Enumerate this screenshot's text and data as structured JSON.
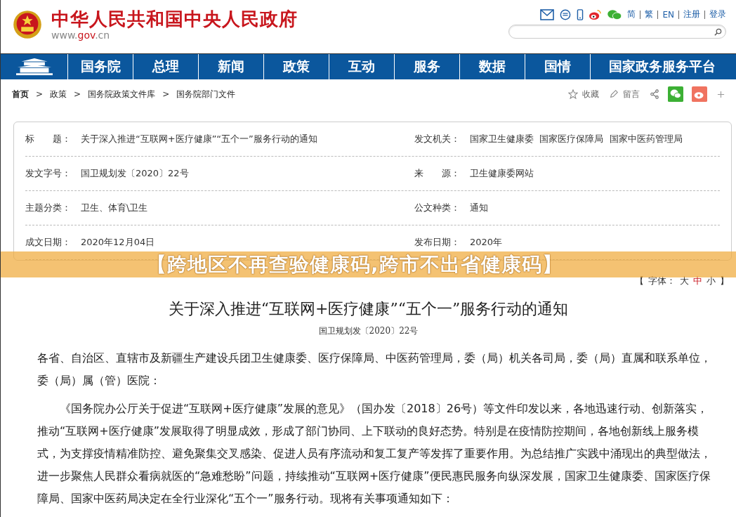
{
  "site": {
    "title": "中华人民共和国中央人民政府",
    "domain_prefix": "www.",
    "domain_main": "gov",
    "domain_suffix": ".cn"
  },
  "top_links": [
    "简",
    "繁",
    "EN",
    "注册",
    "登录"
  ],
  "nav": [
    "国务院",
    "总理",
    "新闻",
    "政策",
    "互动",
    "服务",
    "数据",
    "国情",
    "国家政务服务平台"
  ],
  "breadcrumb": [
    "首页",
    "政策",
    "国务院政策文件库",
    "国务院部门文件"
  ],
  "breadcrumb_sep": ">",
  "actions": {
    "favorite": "收藏",
    "comment": "留言"
  },
  "info": [
    {
      "label": "标　　题：",
      "value": "关于深入推进“互联网+医疗健康”“五个一”服务行动的通知",
      "label2": "发文机关：",
      "value2": "国家卫生健康委  国家医疗保障局  国家中医药管理局"
    },
    {
      "label": "发文字号：",
      "value": "国卫规划发〔2020〕22号",
      "label2": "来　　源：",
      "value2": "卫生健康委网站"
    },
    {
      "label": "主题分类：",
      "value": "卫生、体育\\卫生",
      "label2": "公文种类：",
      "value2": "通知"
    },
    {
      "label": "成文日期：",
      "value": "2020年12月04日",
      "label2": "发布日期：",
      "value2": "2020年"
    }
  ],
  "banner": "【跨地区不再查验健康码,跨市不出省健康码】",
  "font_size": {
    "open": "【",
    "label": "字体：",
    "close": "】",
    "sizes": [
      {
        "label": "大",
        "selected": false
      },
      {
        "label": "中",
        "selected": true
      },
      {
        "label": "小",
        "selected": false
      }
    ]
  },
  "article": {
    "title": "关于深入推进“互联网+医疗健康”“五个一”服务行动的通知",
    "doc_number": "国卫规划发〔2020〕22号",
    "paragraphs": [
      {
        "kind": "salutation",
        "text": "各省、自治区、直辖市及新疆生产建设兵团卫生健康委、医疗保障局、中医药管理局，委（局）机关各司局，委（局）直属和联系单位，委（局）属（管）医院："
      },
      {
        "kind": "body",
        "text": "《国务院办公厅关于促进“互联网+医疗健康”发展的意见》（国办发〔2018〕26号）等文件印发以来，各地迅速行动、创新落实，推动“互联网+医疗健康”发展取得了明显成效，形成了部门协同、上下联动的良好态势。特别是在疫情防控期间，各地创新线上服务模式，为支撑疫情精准防控、避免聚集交叉感染、促进人员有序流动和复工复产等发挥了重要作用。为总结推广实践中涌现出的典型做法，进一步聚焦人民群众看病就医的“急难愁盼”问题，持续推动“互联网+医疗健康”便民惠民服务向纵深发展，国家卫生健康委、国家医疗保障局、国家中医药局决定在全行业深化“五个一”服务行动。现将有关事项通知如下："
      }
    ]
  }
}
